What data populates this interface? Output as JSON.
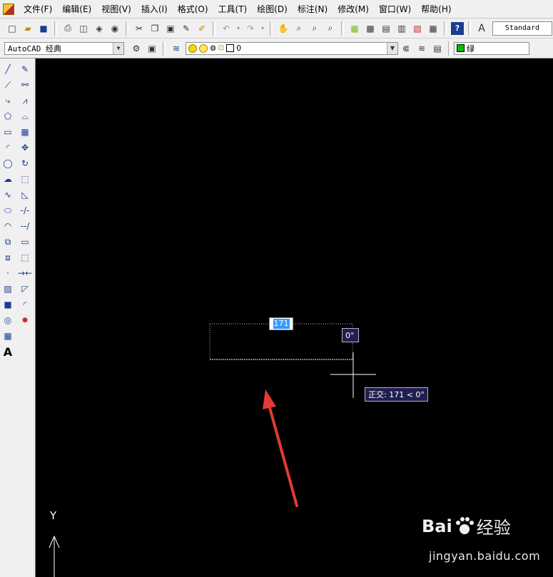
{
  "menu": {
    "items": [
      "文件(F)",
      "编辑(E)",
      "视图(V)",
      "插入(I)",
      "格式(O)",
      "工具(T)",
      "绘图(D)",
      "标注(N)",
      "修改(M)",
      "窗口(W)",
      "帮助(H)"
    ]
  },
  "toolbar": {
    "workspace_value": "AutoCAD 经典",
    "text_style_value": "Standard",
    "layer_value": "0",
    "color_value": "绿"
  },
  "colors": {
    "canvas": "#000000",
    "tooltip_bg": "#1f2050",
    "selection": "#3399ff",
    "arrow": "#e53935",
    "layer_color": "#00c000"
  },
  "dimension": {
    "length_input": "171",
    "angle": "0°",
    "ortho_tooltip": "正交: 171 < 0°"
  },
  "ucs": {
    "y_label": "Y"
  },
  "watermark": {
    "brand": "Bai",
    "brand_suffix": "经验",
    "url": "jingyan.baidu.com"
  }
}
